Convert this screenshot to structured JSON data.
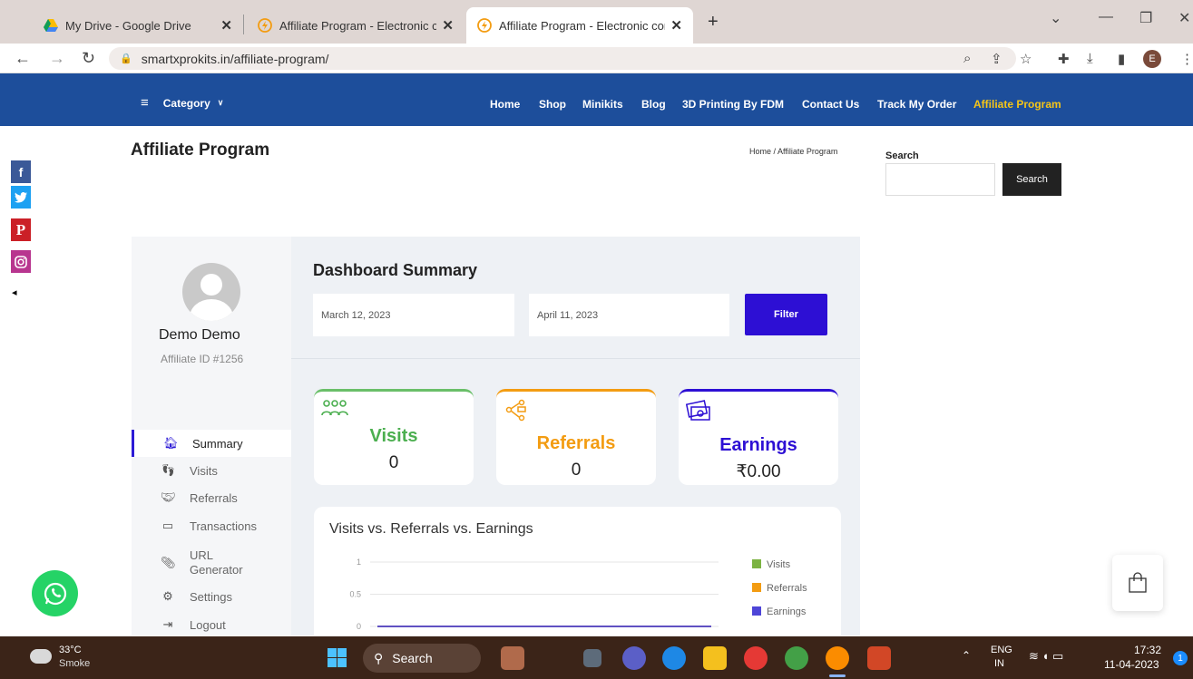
{
  "browser": {
    "tabs": [
      {
        "title": "My Drive - Google Drive",
        "active": false
      },
      {
        "title": "Affiliate Program - Electronic com",
        "active": false
      },
      {
        "title": "Affiliate Program - Electronic com",
        "active": true
      }
    ],
    "new_tab": "+",
    "url": "smartxprokits.in/affiliate-program/",
    "profile_letter": "E"
  },
  "nav": {
    "category_label": "Category",
    "menu": [
      "Home",
      "Shop",
      "Minikits",
      "Blog",
      "3D Printing By FDM",
      "Contact Us",
      "Track My Order",
      "Affiliate Program"
    ],
    "active_color": "#f5c518",
    "bar_color": "#1d4e9b"
  },
  "social": {
    "facebook": "f",
    "pinterest": "P"
  },
  "page": {
    "title": "Affiliate Program",
    "breadcrumb": "Home /  Affiliate Program"
  },
  "search": {
    "label": "Search",
    "button": "Search"
  },
  "affiliate": {
    "name": "Demo Demo",
    "id_text": "Affiliate ID #1256"
  },
  "sidebar": {
    "items": [
      {
        "label": "Summary",
        "icon": "home-icon"
      },
      {
        "label": "Visits",
        "icon": "visits-icon"
      },
      {
        "label": "Referrals",
        "icon": "handshake-icon"
      },
      {
        "label": "Transactions",
        "icon": "card-icon"
      },
      {
        "label": "URL Generator",
        "icon": "paperclip-icon"
      },
      {
        "label": "Settings",
        "icon": "gear-icon"
      },
      {
        "label": "Logout",
        "icon": "logout-icon"
      }
    ]
  },
  "dashboard": {
    "title": "Dashboard Summary",
    "start_date": "March 12, 2023",
    "end_date": "April 11, 2023",
    "filter_label": "Filter",
    "accent": "#2d0fd4"
  },
  "stats": {
    "visits": {
      "label": "Visits",
      "value": "0",
      "color": "#4caf50"
    },
    "referrals": {
      "label": "Referrals",
      "value": "0",
      "color": "#f39c12"
    },
    "earnings": {
      "label": "Earnings",
      "value": "₹0.00",
      "color": "#2d0fd4"
    }
  },
  "chart": {
    "title": "Visits vs. Referrals vs. Earnings"
  },
  "chart_data": {
    "type": "line",
    "title": "Visits vs. Referrals vs. Earnings",
    "ylim": [
      0,
      1
    ],
    "y_ticks": [
      "1",
      "0.5",
      "0"
    ],
    "series": [
      {
        "name": "Visits",
        "color": "#7cb342",
        "values": [
          0,
          0
        ]
      },
      {
        "name": "Referrals",
        "color": "#f39c12",
        "values": [
          0,
          0
        ]
      },
      {
        "name": "Earnings",
        "color": "#4e45d8",
        "values": [
          0,
          0
        ]
      }
    ]
  },
  "taskbar": {
    "weather_temp": "33°C",
    "weather_text": "Smoke",
    "search": "Search",
    "lang_top": "ENG",
    "lang_bottom": "IN",
    "time": "17:32",
    "date": "11-04-2023",
    "notifications": "1"
  }
}
